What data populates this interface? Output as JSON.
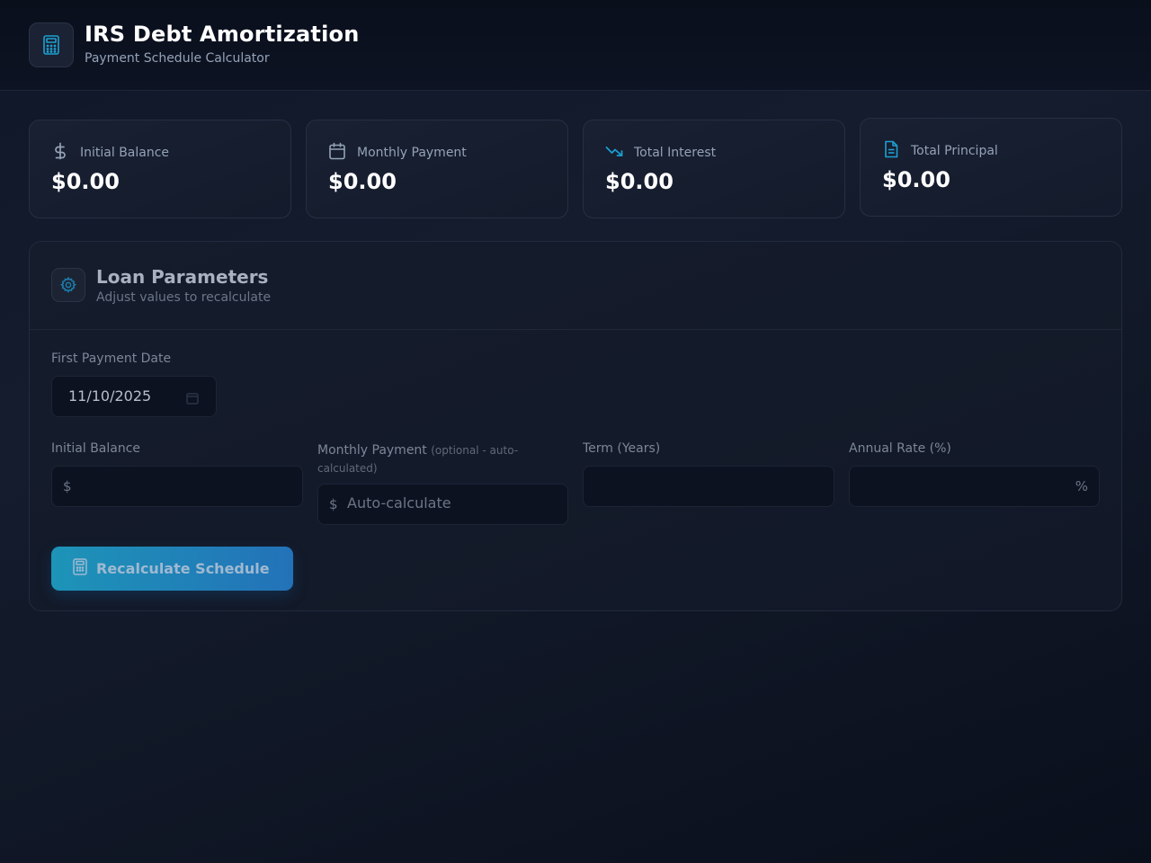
{
  "app": {
    "title": "IRS Debt Amortization",
    "subtitle": "Payment Schedule Calculator",
    "logo_icon": "calculator-icon"
  },
  "stats": [
    {
      "label": "Initial Balance",
      "value": "$0.00",
      "icon": "dollar-icon"
    },
    {
      "label": "Monthly Payment",
      "value": "$0.00",
      "icon": "calendar-icon"
    },
    {
      "label": "Total Interest",
      "value": "$0.00",
      "icon": "trending-down-icon"
    },
    {
      "label": "Total Principal",
      "value": "$0.00",
      "icon": "document-icon"
    }
  ],
  "parameters": {
    "title": "Loan Parameters",
    "subtitle": "Adjust values to recalculate",
    "first_payment_date": {
      "label": "First Payment Date",
      "value": "11/10/2025"
    },
    "initial_balance": {
      "label": "Initial Balance",
      "prefix": "$",
      "value": ""
    },
    "monthly_payment": {
      "label": "Monthly Payment",
      "note": "(optional - auto-calculated)",
      "prefix": "$",
      "placeholder": "Auto-calculate",
      "value": ""
    },
    "term": {
      "label": "Term (Years)",
      "value": ""
    },
    "annual_rate": {
      "label": "Annual Rate (%)",
      "suffix": "%",
      "value": ""
    },
    "recalculate_label": "Recalculate Schedule"
  },
  "colors": {
    "accent": "#1d94b8",
    "accent_end": "#2372b8",
    "background": "#111827"
  }
}
